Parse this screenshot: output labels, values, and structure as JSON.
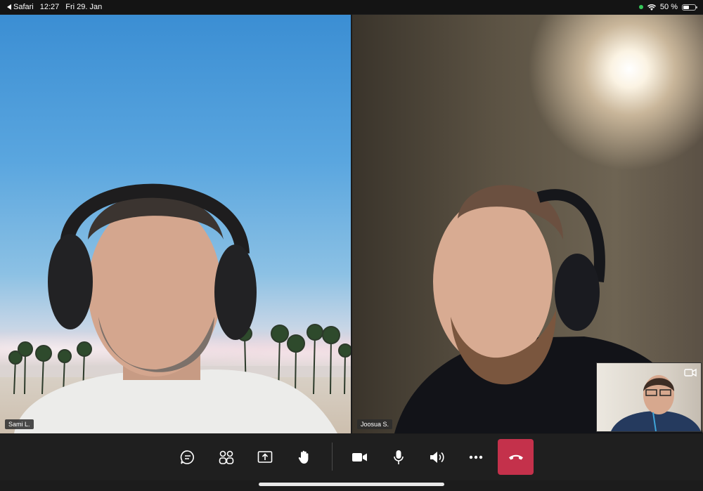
{
  "status_bar": {
    "back_app": "Safari",
    "time": "12:27",
    "date": "Fri 29. Jan",
    "battery": "50 %",
    "battery_level": 0.5
  },
  "participants": [
    {
      "name": "Sami L."
    },
    {
      "name": "Joosua S."
    }
  ],
  "controls": {
    "items": [
      "chat-icon",
      "participants-icon",
      "share-screen-icon",
      "raise-hand-icon",
      "camera-icon",
      "microphone-icon",
      "speaker-icon",
      "more-options-icon",
      "hang-up-icon"
    ],
    "hangup_color": "#c4314b"
  }
}
